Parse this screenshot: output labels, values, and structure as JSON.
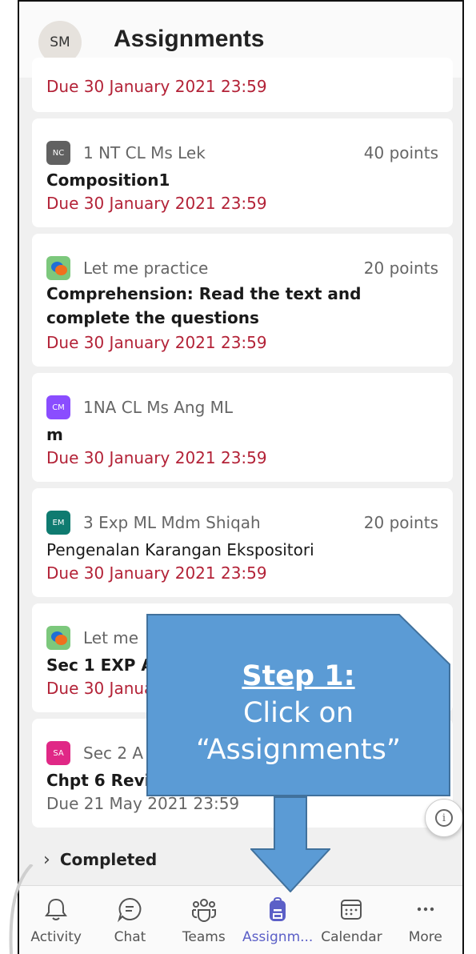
{
  "header": {
    "avatar_initials": "SM",
    "title": "Assignments"
  },
  "top_card": {
    "due": "Due 30 January 2021 23:59"
  },
  "cards": [
    {
      "badge": "NC",
      "badge_color": "#616161",
      "course": "1 NT CL Ms Lek",
      "points": "40 points",
      "title": "Composition1",
      "due": "Due 30 January 2021 23:59"
    },
    {
      "badge_icon": "chat-bubbles-icon",
      "course": "Let me practice",
      "points": "20 points",
      "title": "Comprehension: Read the text and complete the questions",
      "due": "Due 30 January 2021 23:59"
    },
    {
      "badge": "CM",
      "badge_color": "#8a4dff",
      "course": "1NA CL Ms Ang ML",
      "points": "",
      "title": "m",
      "due": "Due 30 January 2021 23:59"
    },
    {
      "badge": "EM",
      "badge_color": "#0f7b70",
      "course": "3 Exp ML Mdm Shiqah",
      "points": "20 points",
      "title": "Pengenalan Karangan Ekspositori",
      "due": "Due 30 January 2021 23:59"
    },
    {
      "badge_icon": "chat-bubbles-icon",
      "course": "Let me",
      "points": "",
      "title": "Sec 1 EXP Ar",
      "due": "Due 30 Janua"
    },
    {
      "badge": "SA",
      "badge_color": "#e02886",
      "course": "Sec 2 A",
      "points": "",
      "title": "Chpt 6 Revis",
      "due": "Due 21 May 2021 23:59"
    }
  ],
  "completed": {
    "label": "Completed"
  },
  "info_icon": "info-icon",
  "nav": [
    {
      "label": "Activity",
      "icon": "bell-icon"
    },
    {
      "label": "Chat",
      "icon": "chat-icon"
    },
    {
      "label": "Teams",
      "icon": "teams-icon"
    },
    {
      "label": "Assignm...",
      "icon": "backpack-icon",
      "active": true
    },
    {
      "label": "Calendar",
      "icon": "calendar-icon"
    },
    {
      "label": "More",
      "icon": "more-icon"
    }
  ],
  "callout": {
    "step": "Step 1:",
    "line1": "Click on",
    "line2": "“Assignments”"
  },
  "colors": {
    "accent": "#5b5fc7",
    "due_red": "#b32237",
    "callout_fill": "#5b9bd5",
    "callout_stroke": "#41719c"
  }
}
